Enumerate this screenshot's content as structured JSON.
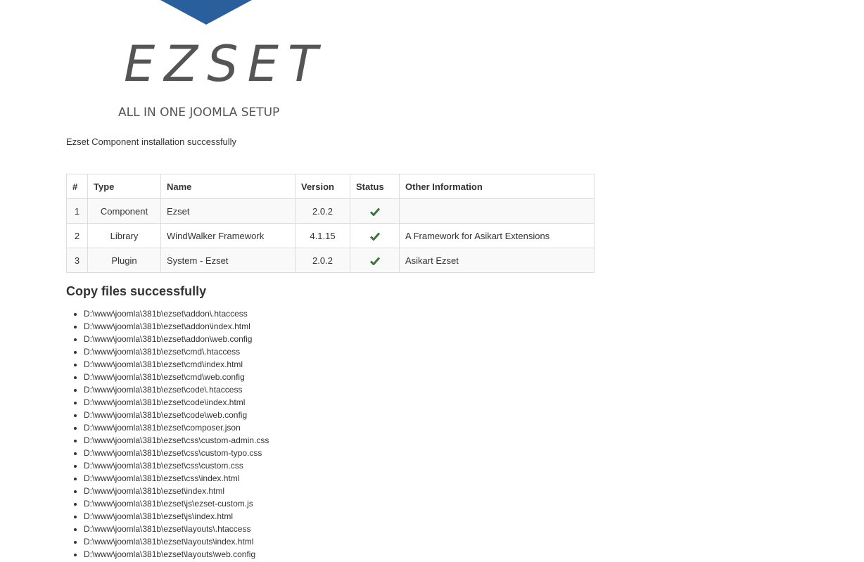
{
  "brand": {
    "wordmark": "EZSET",
    "tagline": "ALL IN ONE JOOMLA SETUP",
    "accent_color": "#2a5f9e",
    "icon": "logo-chevron-icon"
  },
  "message": "Ezset Component installation successfully",
  "table": {
    "headers": [
      "#",
      "Type",
      "Name",
      "Version",
      "Status",
      "Other Information"
    ],
    "rows": [
      {
        "num": "1",
        "type": "Component",
        "name": "Ezset",
        "version": "2.0.2",
        "status": "check-icon",
        "info": ""
      },
      {
        "num": "2",
        "type": "Library",
        "name": "WindWalker Framework",
        "version": "4.1.15",
        "status": "check-icon",
        "info": "A Framework for Asikart Extensions"
      },
      {
        "num": "3",
        "type": "Plugin",
        "name": "System - Ezset",
        "version": "2.0.2",
        "status": "check-icon",
        "info": "Asikart Ezset"
      }
    ],
    "status_color": "#3c763d"
  },
  "copy_section": {
    "heading": "Copy files successfully",
    "files": [
      "D:\\www\\joomla\\381b\\ezset\\addon\\.htaccess",
      "D:\\www\\joomla\\381b\\ezset\\addon\\index.html",
      "D:\\www\\joomla\\381b\\ezset\\addon\\web.config",
      "D:\\www\\joomla\\381b\\ezset\\cmd\\.htaccess",
      "D:\\www\\joomla\\381b\\ezset\\cmd\\index.html",
      "D:\\www\\joomla\\381b\\ezset\\cmd\\web.config",
      "D:\\www\\joomla\\381b\\ezset\\code\\.htaccess",
      "D:\\www\\joomla\\381b\\ezset\\code\\index.html",
      "D:\\www\\joomla\\381b\\ezset\\code\\web.config",
      "D:\\www\\joomla\\381b\\ezset\\composer.json",
      "D:\\www\\joomla\\381b\\ezset\\css\\custom-admin.css",
      "D:\\www\\joomla\\381b\\ezset\\css\\custom-typo.css",
      "D:\\www\\joomla\\381b\\ezset\\css\\custom.css",
      "D:\\www\\joomla\\381b\\ezset\\css\\index.html",
      "D:\\www\\joomla\\381b\\ezset\\index.html",
      "D:\\www\\joomla\\381b\\ezset\\js\\ezset-custom.js",
      "D:\\www\\joomla\\381b\\ezset\\js\\index.html",
      "D:\\www\\joomla\\381b\\ezset\\layouts\\.htaccess",
      "D:\\www\\joomla\\381b\\ezset\\layouts\\index.html",
      "D:\\www\\joomla\\381b\\ezset\\layouts\\web.config"
    ]
  }
}
